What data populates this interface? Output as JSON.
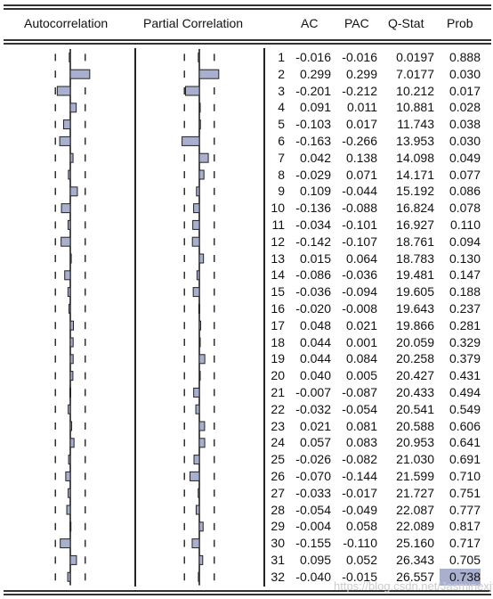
{
  "headers": {
    "autocorrelation": "Autocorrelation",
    "partial": "Partial Correlation",
    "ac": "AC",
    "pac": "PAC",
    "qstat": "Q-Stat",
    "prob": "Prob"
  },
  "colors": {
    "bar_fill": "#a9b0cf",
    "bar_border": "#222222",
    "selected_cell": "#a9b0cf"
  },
  "confidence_bound": 0.23,
  "selected": {
    "row": 32,
    "column": "prob"
  },
  "watermark": "https://blog.csdn.net/Jasminexjf",
  "rows": [
    {
      "lag": "1",
      "ac": "-0.016",
      "pac": "-0.016",
      "q": "0.0197",
      "p": "0.888"
    },
    {
      "lag": "2",
      "ac": "0.299",
      "pac": "0.299",
      "q": "7.0177",
      "p": "0.030"
    },
    {
      "lag": "3",
      "ac": "-0.201",
      "pac": "-0.212",
      "q": "10.212",
      "p": "0.017"
    },
    {
      "lag": "4",
      "ac": "0.091",
      "pac": "0.011",
      "q": "10.881",
      "p": "0.028"
    },
    {
      "lag": "5",
      "ac": "-0.103",
      "pac": "0.017",
      "q": "11.743",
      "p": "0.038"
    },
    {
      "lag": "6",
      "ac": "-0.163",
      "pac": "-0.266",
      "q": "13.953",
      "p": "0.030"
    },
    {
      "lag": "7",
      "ac": "0.042",
      "pac": "0.138",
      "q": "14.098",
      "p": "0.049"
    },
    {
      "lag": "8",
      "ac": "-0.029",
      "pac": "0.071",
      "q": "14.171",
      "p": "0.077"
    },
    {
      "lag": "9",
      "ac": "0.109",
      "pac": "-0.044",
      "q": "15.192",
      "p": "0.086"
    },
    {
      "lag": "10",
      "ac": "-0.136",
      "pac": "-0.088",
      "q": "16.824",
      "p": "0.078"
    },
    {
      "lag": "11",
      "ac": "-0.034",
      "pac": "-0.101",
      "q": "16.927",
      "p": "0.110"
    },
    {
      "lag": "12",
      "ac": "-0.142",
      "pac": "-0.107",
      "q": "18.761",
      "p": "0.094"
    },
    {
      "lag": "13",
      "ac": "0.015",
      "pac": "0.064",
      "q": "18.783",
      "p": "0.130"
    },
    {
      "lag": "14",
      "ac": "-0.086",
      "pac": "-0.036",
      "q": "19.481",
      "p": "0.147"
    },
    {
      "lag": "15",
      "ac": "-0.036",
      "pac": "-0.094",
      "q": "19.605",
      "p": "0.188"
    },
    {
      "lag": "16",
      "ac": "-0.020",
      "pac": "-0.008",
      "q": "19.643",
      "p": "0.237"
    },
    {
      "lag": "17",
      "ac": "0.048",
      "pac": "0.021",
      "q": "19.866",
      "p": "0.281"
    },
    {
      "lag": "18",
      "ac": "0.044",
      "pac": "0.001",
      "q": "20.059",
      "p": "0.329"
    },
    {
      "lag": "19",
      "ac": "0.044",
      "pac": "0.084",
      "q": "20.258",
      "p": "0.379"
    },
    {
      "lag": "20",
      "ac": "0.040",
      "pac": "0.005",
      "q": "20.427",
      "p": "0.431"
    },
    {
      "lag": "21",
      "ac": "-0.007",
      "pac": "-0.087",
      "q": "20.433",
      "p": "0.494"
    },
    {
      "lag": "22",
      "ac": "-0.032",
      "pac": "-0.054",
      "q": "20.541",
      "p": "0.549"
    },
    {
      "lag": "23",
      "ac": "0.021",
      "pac": "0.081",
      "q": "20.588",
      "p": "0.606"
    },
    {
      "lag": "24",
      "ac": "0.057",
      "pac": "0.083",
      "q": "20.953",
      "p": "0.641"
    },
    {
      "lag": "25",
      "ac": "-0.026",
      "pac": "-0.082",
      "q": "21.030",
      "p": "0.691"
    },
    {
      "lag": "26",
      "ac": "-0.070",
      "pac": "-0.144",
      "q": "21.599",
      "p": "0.710"
    },
    {
      "lag": "27",
      "ac": "-0.033",
      "pac": "-0.017",
      "q": "21.727",
      "p": "0.751"
    },
    {
      "lag": "28",
      "ac": "-0.054",
      "pac": "-0.049",
      "q": "22.087",
      "p": "0.777"
    },
    {
      "lag": "29",
      "ac": "-0.004",
      "pac": "0.058",
      "q": "22.089",
      "p": "0.817"
    },
    {
      "lag": "30",
      "ac": "-0.155",
      "pac": "-0.110",
      "q": "25.160",
      "p": "0.717"
    },
    {
      "lag": "31",
      "ac": "0.095",
      "pac": "0.052",
      "q": "26.343",
      "p": "0.705"
    },
    {
      "lag": "32",
      "ac": "-0.040",
      "pac": "-0.015",
      "q": "26.557",
      "p": "0.738"
    }
  ]
}
